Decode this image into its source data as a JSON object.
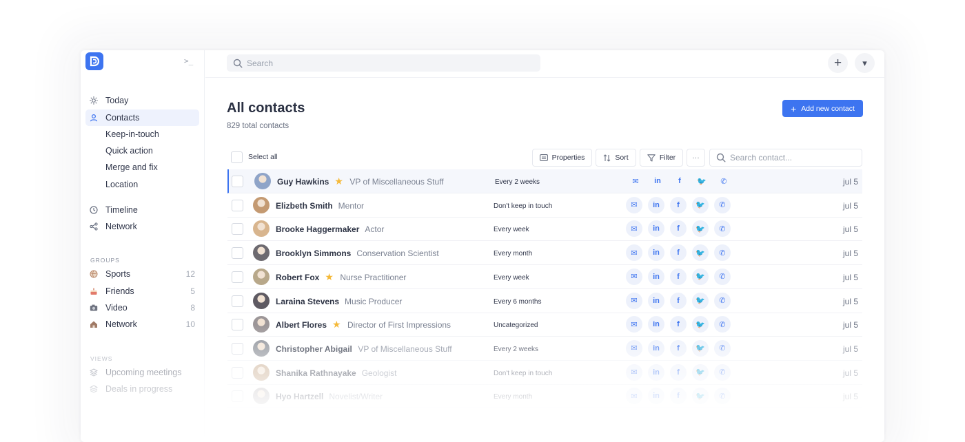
{
  "app": {
    "brand_color": "#3d74f0"
  },
  "sidebar": {
    "collapse_glyph": ">_",
    "nav": [
      {
        "label": "Today",
        "icon": "sun-icon"
      },
      {
        "label": "Contacts",
        "icon": "user-icon",
        "active": true
      },
      {
        "label": "Keep-in-touch"
      },
      {
        "label": "Quick action"
      },
      {
        "label": "Merge and fix"
      },
      {
        "label": "Location"
      },
      {
        "label": "Timeline",
        "icon": "clock-icon"
      },
      {
        "label": "Network",
        "icon": "share-icon"
      }
    ],
    "groups_heading": "GROUPS",
    "groups": [
      {
        "label": "Sports",
        "count": "12",
        "icon": "volleyball-icon"
      },
      {
        "label": "Friends",
        "count": "5",
        "icon": "cake-icon"
      },
      {
        "label": "Video",
        "count": "8",
        "icon": "camera-icon"
      },
      {
        "label": "Network",
        "count": "10",
        "icon": "house-icon"
      }
    ],
    "views_heading": "VIEWS",
    "views": [
      {
        "label": "Upcoming meetings",
        "icon": "layers-icon"
      },
      {
        "label": "Deals in progress",
        "icon": "layers-icon"
      }
    ]
  },
  "topbar": {
    "search_placeholder": "Search",
    "plus_glyph": "+",
    "caret_glyph": "▾"
  },
  "main": {
    "title": "All contacts",
    "subtitle": "829 total contacts",
    "add_button": "Add new contact",
    "add_button_plus": "+",
    "select_all": "Select all",
    "toolbar": {
      "properties": "Properties",
      "sort": "Sort",
      "filter": "Filter",
      "more": "···",
      "search_placeholder": "Search contact..."
    }
  },
  "contacts": [
    {
      "name": "Guy Hawkins",
      "starred": true,
      "role": "VP of Miscellaneous Stuff",
      "frequency": "Every 2 weeks",
      "date": "jul 5",
      "avatar_color": "#8fa4c8"
    },
    {
      "name": "Elizbeth Smith",
      "starred": false,
      "role": "Mentor",
      "frequency": "Don't keep in touch",
      "date": "jul 5",
      "avatar_color": "#c49a72"
    },
    {
      "name": "Brooke Haggermaker",
      "starred": false,
      "role": "Actor",
      "frequency": "Every week",
      "date": "jul 5",
      "avatar_color": "#d8b58e"
    },
    {
      "name": "Brooklyn Simmons",
      "starred": false,
      "role": "Conservation Scientist",
      "frequency": "Every month",
      "date": "jul 5",
      "avatar_color": "#6d6a70"
    },
    {
      "name": "Robert Fox",
      "starred": true,
      "role": "Nurse Practitioner",
      "frequency": "Every week",
      "date": "jul 5",
      "avatar_color": "#b8a88a"
    },
    {
      "name": "Laraina Stevens",
      "starred": false,
      "role": "Music Producer",
      "frequency": "Every 6 months",
      "date": "jul 5",
      "avatar_color": "#5e5a62"
    },
    {
      "name": "Albert Flores",
      "starred": true,
      "role": "Director of First Impressions",
      "frequency": "Uncategorized",
      "date": "jul 5",
      "avatar_color": "#9c9698"
    },
    {
      "name": "Christopher Abigail",
      "starred": false,
      "role": "VP of Miscellaneous Stuff",
      "frequency": "Every 2 weeks",
      "date": "jul 5",
      "avatar_color": "#8a8e96"
    },
    {
      "name": "Shanika Rathnayake",
      "starred": false,
      "role": "Geologist",
      "frequency": "Don't keep in touch",
      "date": "jul 5",
      "avatar_color": "#c7a98c"
    },
    {
      "name": "Hyo Hartzell",
      "starred": false,
      "role": "Novelist/Writer",
      "frequency": "Every month",
      "date": "jul 5",
      "avatar_color": "#b5b0b4"
    }
  ],
  "social_icons": [
    {
      "name": "mail-icon",
      "glyph": "✉"
    },
    {
      "name": "linkedin-icon",
      "glyph": "in"
    },
    {
      "name": "facebook-icon",
      "glyph": "f"
    },
    {
      "name": "twitter-icon",
      "glyph": "🐦"
    },
    {
      "name": "whatsapp-icon",
      "glyph": "✆"
    }
  ]
}
